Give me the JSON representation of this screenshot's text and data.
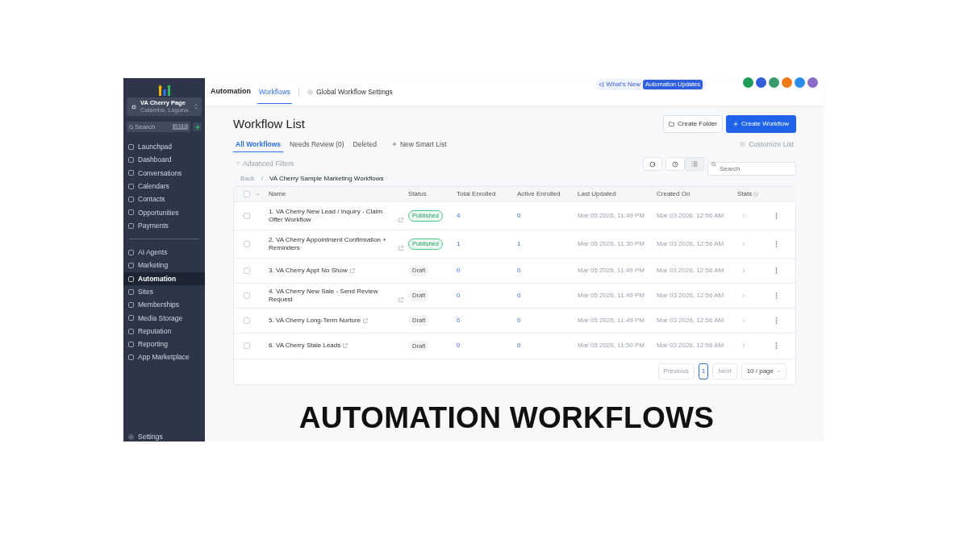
{
  "sidebar": {
    "account": {
      "name": "VA Cherry Page",
      "location": "Calamba, Laguna"
    },
    "search": {
      "placeholder": "Search",
      "shortcut": "ctrl K"
    },
    "groups": [
      [
        {
          "label": "Launchpad",
          "selected": false
        },
        {
          "label": "Dashboard",
          "selected": false
        },
        {
          "label": "Conversations",
          "selected": false
        },
        {
          "label": "Calendars",
          "selected": false
        },
        {
          "label": "Contacts",
          "selected": false
        },
        {
          "label": "Opportunities",
          "selected": false
        },
        {
          "label": "Payments",
          "selected": false
        }
      ],
      [
        {
          "label": "AI Agents",
          "selected": false
        },
        {
          "label": "Marketing",
          "selected": false
        },
        {
          "label": "Automation",
          "selected": true
        },
        {
          "label": "Sites",
          "selected": false
        },
        {
          "label": "Memberships",
          "selected": false
        },
        {
          "label": "Media Storage",
          "selected": false
        },
        {
          "label": "Reputation",
          "selected": false
        },
        {
          "label": "Reporting",
          "selected": false
        },
        {
          "label": "App Marketplace",
          "selected": false
        }
      ]
    ],
    "settings": "Settings"
  },
  "header": {
    "title": "Automation",
    "tabs": [
      {
        "label": "Workflows",
        "selected": true
      },
      {
        "label": "Global Workflow Settings",
        "selected": false
      }
    ],
    "whats_new": "What's New",
    "badge": "Automation Updates",
    "avatars": [
      {
        "color": "#1e9e5a"
      },
      {
        "color": "#2f5fd8"
      },
      {
        "color": "#3b9a6b"
      },
      {
        "color": "#f07a1a"
      },
      {
        "color": "#2a8de8"
      },
      {
        "color": "#8a6cc7"
      }
    ]
  },
  "page": {
    "title": "Workflow List",
    "buttons": [
      "Create Folder",
      "Create Workflow"
    ],
    "tabs": [
      {
        "label": "All Workflows",
        "selected": true
      },
      {
        "label": "Needs Review (0)",
        "selected": false
      },
      {
        "label": "Deleted",
        "selected": false
      }
    ],
    "new_smart_list": "New Smart List",
    "customize": "Customize List",
    "filters": "Advanced Filters",
    "search": {
      "placeholder": "Search"
    },
    "breadcrumb": [
      "Back",
      "VA Cherry Sample Marketing Workflows"
    ],
    "breadcrumb_separator": "/"
  },
  "table": {
    "select_all_checked": false,
    "columns": [
      "Name",
      "Status",
      "Total Enrolled",
      "Active Enrolled",
      "Last Updated",
      "Created On",
      "Stats"
    ],
    "rows": [
      {
        "name": "1. VA Cherry New Lead / Inquiry - Claim Offer Workflow",
        "status": {
          "label": "Published",
          "kind": "published"
        },
        "total": "4",
        "active": "0",
        "updated": "Mar 05 2026, 11:49 PM",
        "created": "Mar 03 2026, 12:56 AM",
        "checked": false
      },
      {
        "name": "2. VA Cherry Appointment Confirmation + Reminders",
        "status": {
          "label": "Published",
          "kind": "published"
        },
        "total": "1",
        "active": "1",
        "updated": "Mar 05 2026, 11:30 PM",
        "created": "Mar 03 2026, 12:56 AM",
        "checked": false
      },
      {
        "name": "3. VA Cherry Appt No Show",
        "status": {
          "label": "Draft",
          "kind": "draft"
        },
        "total": "0",
        "active": "0",
        "updated": "Mar 05 2026, 11:49 PM",
        "created": "Mar 03 2026, 12:56 AM",
        "checked": false
      },
      {
        "name": "4. VA Cherry New Sale - Send Review Request",
        "status": {
          "label": "Draft",
          "kind": "draft"
        },
        "total": "0",
        "active": "0",
        "updated": "Mar 05 2026, 11:49 PM",
        "created": "Mar 03 2026, 12:56 AM",
        "checked": false
      },
      {
        "name": "5. VA Cherry Long-Term Nurture",
        "status": {
          "label": "Draft",
          "kind": "draft"
        },
        "total": "0",
        "active": "0",
        "updated": "Mar 05 2026, 11:49 PM",
        "created": "Mar 03 2026, 12:56 AM",
        "checked": false
      },
      {
        "name": "6. VA Cherry Stale Leads",
        "status": {
          "label": "Draft",
          "kind": "draft"
        },
        "total": "0",
        "active": "0",
        "updated": "Mar 05 2026, 11:50 PM",
        "created": "Mar 03 2026, 12:56 AM",
        "checked": false
      }
    ]
  },
  "pagination": {
    "previous": "Previous",
    "pages": [
      {
        "label": "1",
        "selected": true
      }
    ],
    "next": "Next",
    "page_size": "10 / page"
  },
  "caption": "AUTOMATION WORKFLOWS"
}
